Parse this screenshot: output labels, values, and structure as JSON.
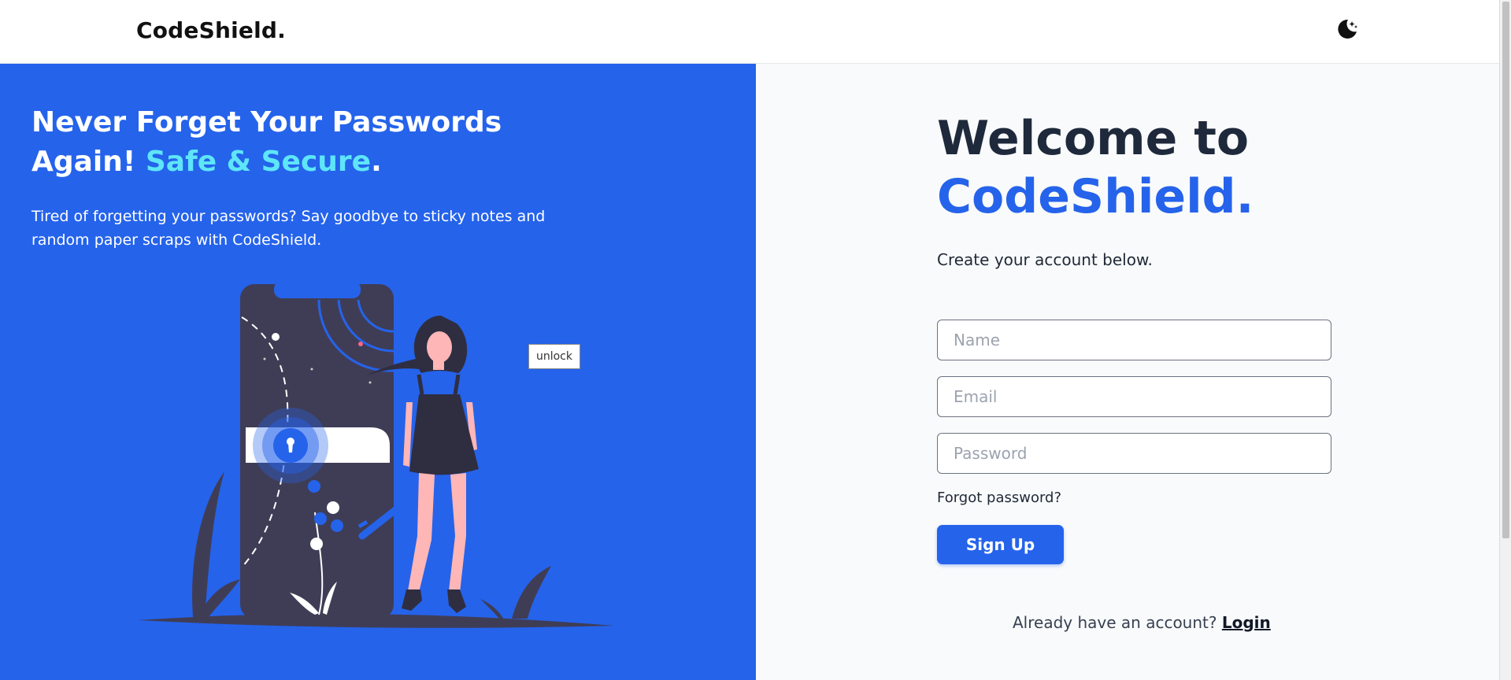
{
  "header": {
    "logo": "CodeShield.",
    "theme_toggle_icon": "moon-stars-icon"
  },
  "hero": {
    "title_line1": "Never Forget Your Passwords",
    "title_line2_prefix": "Again! ",
    "title_accent": "Safe & Secure",
    "title_suffix": ".",
    "description": "Tired of forgetting your passwords? Say goodbye to sticky notes and random paper scraps with CodeShield.",
    "tooltip": "unlock"
  },
  "form": {
    "welcome": "Welcome to",
    "brand": "CodeShield.",
    "subtitle": "Create your account below.",
    "name_placeholder": "Name",
    "email_placeholder": "Email",
    "password_placeholder": "Password",
    "forgot_password": "Forgot password?",
    "signup_label": "Sign Up",
    "have_account": "Already have an account?",
    "login_label": "Login"
  },
  "colors": {
    "primary": "#2563eb",
    "accent": "#5ee6f8",
    "dark_text": "#1e293b"
  }
}
